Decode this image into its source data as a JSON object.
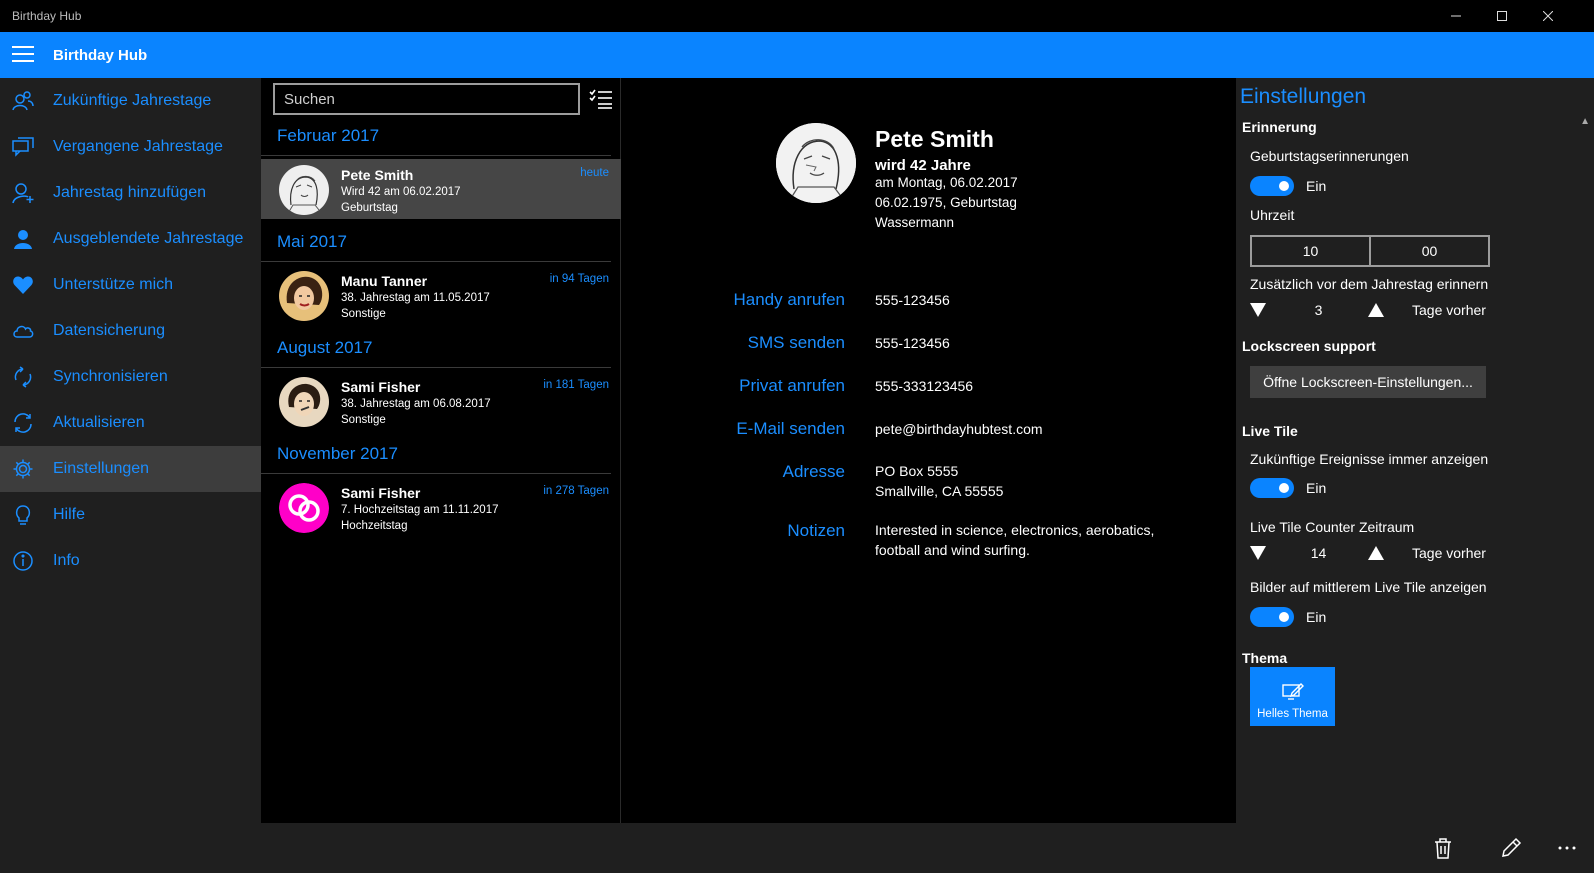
{
  "window": {
    "title": "Birthday Hub",
    "minimize_icon": "minimize-icon",
    "maximize_icon": "maximize-icon",
    "close_icon": "close-icon"
  },
  "header": {
    "title": "Birthday Hub",
    "menu_icon": "hamburger-icon"
  },
  "nav": {
    "accent": "#1b8eff",
    "items": [
      {
        "label": "Zukünftige Jahrestage",
        "icon": "people-icon"
      },
      {
        "label": "Vergangene Jahrestage",
        "icon": "chat-icon"
      },
      {
        "label": "Jahrestag hinzufügen",
        "icon": "add-person-icon"
      },
      {
        "label": "Ausgeblendete Jahrestage",
        "icon": "person-icon"
      },
      {
        "label": "Unterstütze mich",
        "icon": "heart-icon"
      },
      {
        "label": "Datensicherung",
        "icon": "cloud-icon"
      },
      {
        "label": "Synchronisieren",
        "icon": "sync-icon"
      },
      {
        "label": "Aktualisieren",
        "icon": "refresh-icon"
      },
      {
        "label": "Einstellungen",
        "icon": "gear-icon",
        "selected": true
      },
      {
        "label": "Hilfe",
        "icon": "lightbulb-icon"
      },
      {
        "label": "Info",
        "icon": "info-icon"
      }
    ]
  },
  "list": {
    "search_placeholder": "Suchen",
    "groups": [
      {
        "month": "Februar 2017",
        "entries": [
          {
            "name": "Pete Smith",
            "line1": "Wird 42 am 06.02.2017",
            "line2": "Geburtstag",
            "days": "heute",
            "selected": true
          }
        ]
      },
      {
        "month": "Mai 2017",
        "entries": [
          {
            "name": "Manu Tanner",
            "line1": "38. Jahrestag am 11.05.2017",
            "line2": "Sonstige",
            "days": "in 94 Tagen"
          }
        ]
      },
      {
        "month": "August 2017",
        "entries": [
          {
            "name": "Sami Fisher",
            "line1": "38. Jahrestag am 06.08.2017",
            "line2": "Sonstige",
            "days": "in 181 Tagen"
          }
        ]
      },
      {
        "month": "November 2017",
        "entries": [
          {
            "name": "Sami Fisher",
            "line1": "7. Hochzeitstag am 11.11.2017",
            "line2": "Hochzeitstag",
            "days": "in 278 Tagen"
          }
        ]
      }
    ]
  },
  "detail": {
    "name": "Pete Smith",
    "age_line": "wird 42 Jahre",
    "date_line": "am Montag, 06.02.2017",
    "birth_line": "06.02.1975, Geburtstag",
    "sign_line": "Wassermann",
    "fields": [
      {
        "label": "Handy anrufen",
        "value": "555-123456"
      },
      {
        "label": "SMS senden",
        "value": "555-123456"
      },
      {
        "label": "Privat anrufen",
        "value": "555-333123456"
      },
      {
        "label": "E-Mail senden",
        "value": "pete@birthdayhubtest.com"
      },
      {
        "label": "Adresse",
        "value_lines": [
          "PO Box 5555",
          "Smallville, CA 55555"
        ]
      },
      {
        "label": "Notizen",
        "value_lines": [
          "Interested in science, electronics, aerobatics,",
          "football and wind surfing."
        ]
      }
    ]
  },
  "settings": {
    "title": "Einstellungen",
    "reminder": {
      "heading": "Erinnerung",
      "birthday_reminders_label": "Geburtstagserinnerungen",
      "birthday_reminders_state": "Ein",
      "time_label": "Uhrzeit",
      "hour": "10",
      "minute": "00",
      "extra_label": "Zusätzlich vor dem Jahrestag erinnern",
      "extra_days": "3",
      "extra_unit": "Tage vorher"
    },
    "lockscreen": {
      "heading": "Lockscreen support",
      "button": "Öffne Lockscreen-Einstellungen..."
    },
    "live_tile": {
      "heading": "Live Tile",
      "future_label": "Zukünftige Ereignisse immer anzeigen",
      "future_state": "Ein",
      "counter_label": "Live Tile Counter Zeitraum",
      "counter_days": "14",
      "counter_unit": "Tage vorher",
      "images_label": "Bilder auf mittlerem Live Tile anzeigen",
      "images_state": "Ein"
    },
    "theme": {
      "heading": "Thema",
      "tile_label": "Helles Thema",
      "tile_icon": "edit-theme-icon"
    }
  },
  "appbar": {
    "icons": [
      "trash-icon",
      "pencil-icon",
      "more-icon"
    ]
  },
  "colors": {
    "accent": "#0a84ff",
    "pane": "#1f1f1f",
    "selected": "#3d3d3d"
  }
}
